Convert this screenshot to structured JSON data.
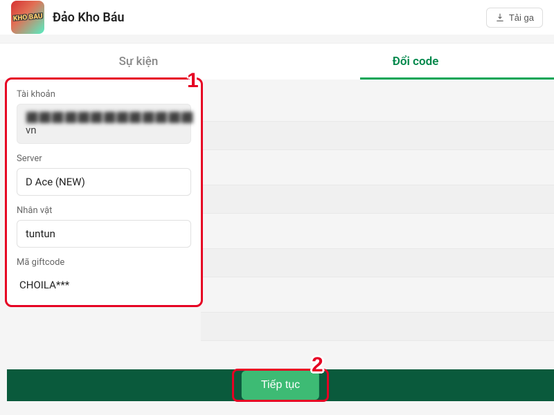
{
  "header": {
    "game_title": "Đảo Kho Báu",
    "game_icon_text": "KHO BAU",
    "download_label": "Tải ga"
  },
  "tabs": {
    "event": "Sự kiện",
    "redeem": "Đổi code"
  },
  "form": {
    "account_label": "Tài khoản",
    "account_masked": "⬛⬛⬛⬛⬛⬛⬛⬛⬛⬛⬛⬛⬛",
    "account_suffix": "vn",
    "server_label": "Server",
    "server_value": "D Ace (NEW)",
    "character_label": "Nhân vật",
    "character_value": "tuntun",
    "giftcode_label": "Mã giftcode",
    "giftcode_value": "CHOILA***"
  },
  "submit": {
    "label": "Tiếp tục"
  },
  "markers": {
    "step1": "1",
    "step2": "2"
  }
}
